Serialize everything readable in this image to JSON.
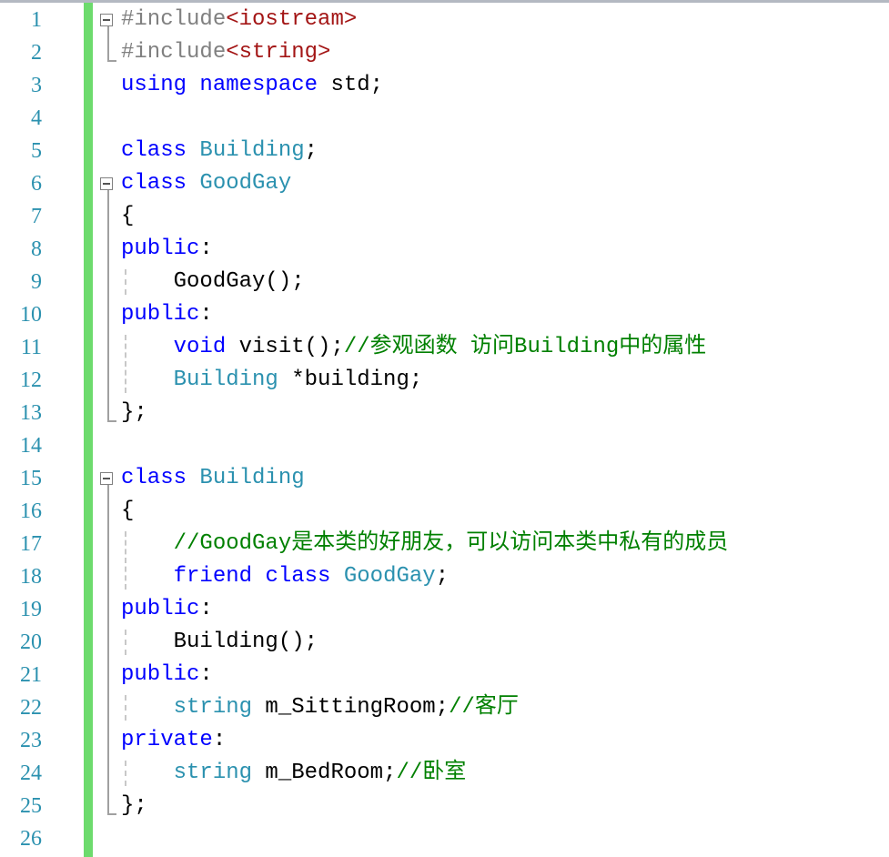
{
  "editor": {
    "accent_colors": {
      "keyword": "#0000ff",
      "type": "#2b91af",
      "preprocessor": "#808080",
      "include_path": "#a31515",
      "comment": "#008000",
      "change_bar": "#6ddb6d"
    },
    "lines": [
      {
        "number": "1",
        "tokens": [
          {
            "t": "#include",
            "c": "pp"
          },
          {
            "t": "<iostream>",
            "c": "st"
          }
        ]
      },
      {
        "number": "2",
        "tokens": [
          {
            "t": "#include",
            "c": "pp"
          },
          {
            "t": "<string>",
            "c": "st"
          }
        ]
      },
      {
        "number": "3",
        "tokens": [
          {
            "t": "using",
            "c": "kw"
          },
          {
            "t": " "
          },
          {
            "t": "namespace",
            "c": "kw"
          },
          {
            "t": " std;"
          }
        ]
      },
      {
        "number": "4",
        "tokens": []
      },
      {
        "number": "5",
        "tokens": [
          {
            "t": "class",
            "c": "kw"
          },
          {
            "t": " "
          },
          {
            "t": "Building",
            "c": "ty"
          },
          {
            "t": ";"
          }
        ]
      },
      {
        "number": "6",
        "tokens": [
          {
            "t": "class",
            "c": "kw"
          },
          {
            "t": " "
          },
          {
            "t": "GoodGay",
            "c": "ty"
          }
        ]
      },
      {
        "number": "7",
        "tokens": [
          {
            "t": "{"
          }
        ]
      },
      {
        "number": "8",
        "tokens": [
          {
            "t": "public",
            "c": "kw"
          },
          {
            "t": ":"
          }
        ]
      },
      {
        "number": "9",
        "tokens": [
          {
            "t": "    GoodGay();"
          }
        ]
      },
      {
        "number": "10",
        "tokens": [
          {
            "t": "public",
            "c": "kw"
          },
          {
            "t": ":"
          }
        ]
      },
      {
        "number": "11",
        "tokens": [
          {
            "t": "    "
          },
          {
            "t": "void",
            "c": "kw"
          },
          {
            "t": " visit();"
          },
          {
            "t": "//参观函数 访问Building中的属性",
            "c": "cm"
          }
        ]
      },
      {
        "number": "12",
        "tokens": [
          {
            "t": "    "
          },
          {
            "t": "Building",
            "c": "ty"
          },
          {
            "t": " *building;"
          }
        ]
      },
      {
        "number": "13",
        "tokens": [
          {
            "t": "};"
          }
        ]
      },
      {
        "number": "14",
        "tokens": []
      },
      {
        "number": "15",
        "tokens": [
          {
            "t": "class",
            "c": "kw"
          },
          {
            "t": " "
          },
          {
            "t": "Building",
            "c": "ty"
          }
        ]
      },
      {
        "number": "16",
        "tokens": [
          {
            "t": "{"
          }
        ]
      },
      {
        "number": "17",
        "tokens": [
          {
            "t": "    "
          },
          {
            "t": "//GoodGay是本类的好朋友，可以访问本类中私有的成员",
            "c": "cm"
          }
        ]
      },
      {
        "number": "18",
        "tokens": [
          {
            "t": "    "
          },
          {
            "t": "friend",
            "c": "kw"
          },
          {
            "t": " "
          },
          {
            "t": "class",
            "c": "kw"
          },
          {
            "t": " "
          },
          {
            "t": "GoodGay",
            "c": "ty"
          },
          {
            "t": ";"
          }
        ]
      },
      {
        "number": "19",
        "tokens": [
          {
            "t": "public",
            "c": "kw"
          },
          {
            "t": ":"
          }
        ]
      },
      {
        "number": "20",
        "tokens": [
          {
            "t": "    Building();"
          }
        ]
      },
      {
        "number": "21",
        "tokens": [
          {
            "t": "public",
            "c": "kw"
          },
          {
            "t": ":"
          }
        ]
      },
      {
        "number": "22",
        "tokens": [
          {
            "t": "    "
          },
          {
            "t": "string",
            "c": "ty"
          },
          {
            "t": " m_SittingRoom;"
          },
          {
            "t": "//客厅",
            "c": "cm"
          }
        ]
      },
      {
        "number": "23",
        "tokens": [
          {
            "t": "private",
            "c": "kw"
          },
          {
            "t": ":"
          }
        ]
      },
      {
        "number": "24",
        "tokens": [
          {
            "t": "    "
          },
          {
            "t": "string",
            "c": "ty"
          },
          {
            "t": " m_BedRoom;"
          },
          {
            "t": "//卧室",
            "c": "cm"
          }
        ]
      },
      {
        "number": "25",
        "tokens": [
          {
            "t": "};"
          }
        ]
      },
      {
        "number": "26",
        "tokens": []
      }
    ]
  }
}
